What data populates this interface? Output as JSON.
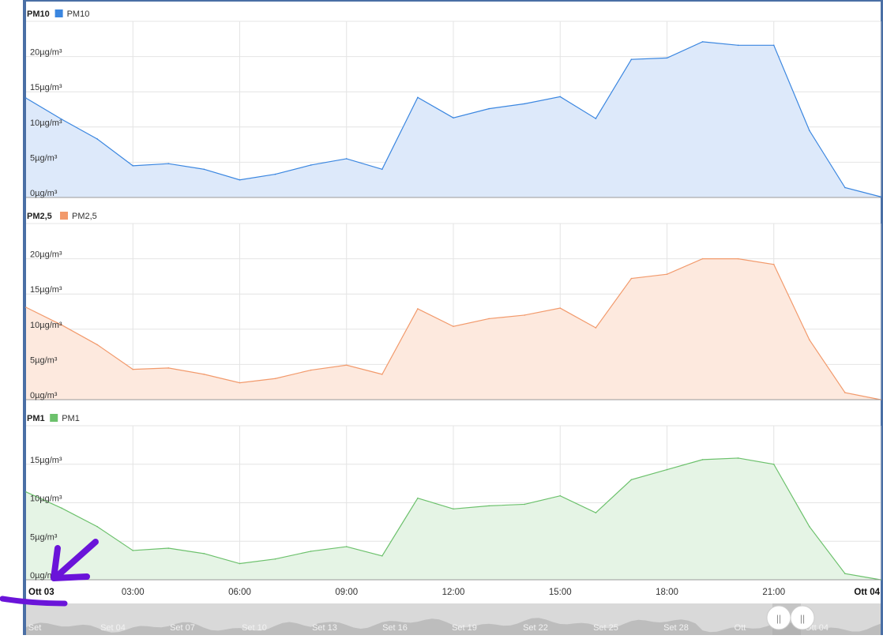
{
  "chart_data": [
    {
      "type": "area",
      "title": "PM10",
      "legend": "PM10",
      "color": "#3a86e0",
      "fill": "#dde9fa",
      "y_ticks": [
        "0µg/m³",
        "5µg/m³",
        "10µg/m³",
        "15µg/m³",
        "20µg/m³"
      ],
      "ylim": [
        0,
        25
      ],
      "x_hours": [
        0,
        1,
        2,
        3,
        4,
        5,
        6,
        7,
        8,
        9,
        10,
        11,
        12,
        13,
        14,
        15,
        16,
        17,
        18,
        19,
        20,
        21,
        22,
        23,
        24
      ],
      "values": [
        14.1,
        11.1,
        8.3,
        4.5,
        4.8,
        4.0,
        2.5,
        3.3,
        4.6,
        5.5,
        4.0,
        14.2,
        11.3,
        12.6,
        13.3,
        14.3,
        11.2,
        19.6,
        19.8,
        22.1,
        21.6,
        21.6,
        9.5,
        1.4,
        0.1
      ]
    },
    {
      "type": "area",
      "title": "PM2,5",
      "legend": "PM2,5",
      "color": "#f29a6c",
      "fill": "#fde9de",
      "y_ticks": [
        "0µg/m³",
        "5µg/m³",
        "10µg/m³",
        "15µg/m³",
        "20µg/m³"
      ],
      "ylim": [
        0,
        25
      ],
      "x_hours": [
        0,
        1,
        2,
        3,
        4,
        5,
        6,
        7,
        8,
        9,
        10,
        11,
        12,
        13,
        14,
        15,
        16,
        17,
        18,
        19,
        20,
        21,
        22,
        23,
        24
      ],
      "values": [
        13.1,
        10.6,
        7.8,
        4.3,
        4.5,
        3.6,
        2.4,
        3.0,
        4.2,
        4.9,
        3.6,
        12.9,
        10.4,
        11.5,
        12.0,
        13.0,
        10.2,
        17.2,
        17.8,
        20.0,
        20.0,
        19.2,
        8.5,
        1.0,
        0.0
      ]
    },
    {
      "type": "area",
      "title": "PM1",
      "legend": "PM1",
      "color": "#6cc16c",
      "fill": "#e5f4e5",
      "y_ticks": [
        "0µg/m³",
        "5µg/m³",
        "10µg/m³",
        "15µg/m³"
      ],
      "ylim": [
        0,
        20
      ],
      "x_hours": [
        0,
        1,
        2,
        3,
        4,
        5,
        6,
        7,
        8,
        9,
        10,
        11,
        12,
        13,
        14,
        15,
        16,
        17,
        18,
        19,
        20,
        21,
        22,
        23,
        24
      ],
      "values": [
        11.4,
        9.3,
        6.9,
        3.8,
        4.1,
        3.4,
        2.1,
        2.7,
        3.7,
        4.3,
        3.1,
        10.6,
        9.2,
        9.6,
        9.8,
        10.9,
        8.7,
        13.0,
        14.3,
        15.6,
        15.8,
        15.0,
        6.9,
        0.8,
        0.0
      ]
    }
  ],
  "x_axis": {
    "ticks": [
      {
        "label": "Ott 03",
        "hour": 0,
        "bold": true
      },
      {
        "label": "03:00",
        "hour": 3,
        "bold": false
      },
      {
        "label": "06:00",
        "hour": 6,
        "bold": false
      },
      {
        "label": "09:00",
        "hour": 9,
        "bold": false
      },
      {
        "label": "12:00",
        "hour": 12,
        "bold": false
      },
      {
        "label": "15:00",
        "hour": 15,
        "bold": false
      },
      {
        "label": "18:00",
        "hour": 18,
        "bold": false
      },
      {
        "label": "21:00",
        "hour": 21,
        "bold": false
      },
      {
        "label": "Ott 04",
        "hour": 24,
        "bold": true
      }
    ]
  },
  "navigator": {
    "labels": [
      "Set",
      "Set 04",
      "Set 07",
      "Set 10",
      "Set 13",
      "Set 16",
      "Set 19",
      "Set 22",
      "Set 25",
      "Set 28",
      "Ott",
      "Ott 04"
    ],
    "handle_glyph": "||"
  },
  "annotation": {
    "color": "#6a14d9"
  }
}
